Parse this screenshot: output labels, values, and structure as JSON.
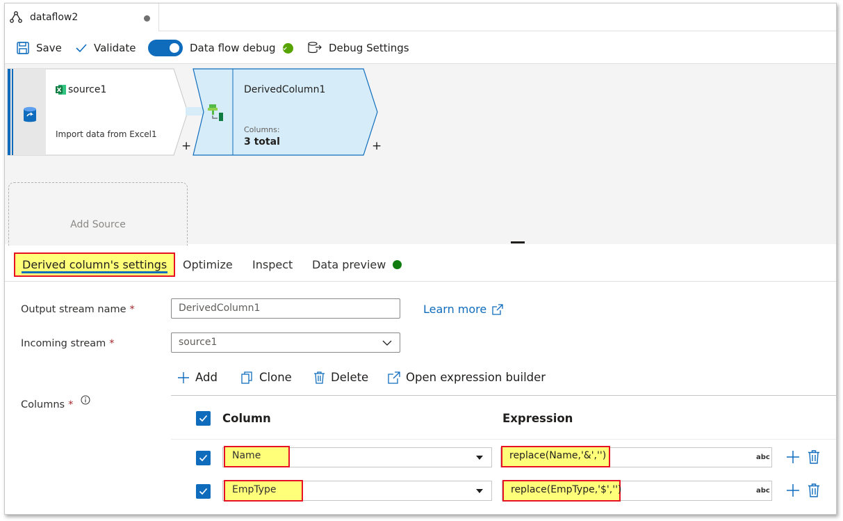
{
  "tab": {
    "title": "dataflow2"
  },
  "toolbar": {
    "save": "Save",
    "validate": "Validate",
    "debug": "Data flow debug",
    "debug_settings": "Debug Settings"
  },
  "canvas": {
    "source": {
      "title": "source1",
      "desc": "Import data from Excel1"
    },
    "derived": {
      "title": "DerivedColumn1",
      "label": "Columns:",
      "value": "3 total"
    },
    "add_source": "Add Source"
  },
  "props": {
    "tabs": [
      "Derived column's settings",
      "Optimize",
      "Inspect",
      "Data preview"
    ],
    "output_label": "Output stream name",
    "output_value": "DerivedColumn1",
    "learn_more": "Learn more",
    "incoming_label": "Incoming stream",
    "incoming_value": "source1",
    "columns_label": "Columns",
    "required_mark": "*",
    "commands": {
      "add": "Add",
      "clone": "Clone",
      "delete": "Delete",
      "open_builder": "Open expression builder"
    },
    "headers": {
      "column": "Column",
      "expression": "Expression"
    },
    "rows": [
      {
        "column": "Name",
        "expression": "replace(Name,'&','')",
        "type": "abc"
      },
      {
        "column": "EmpType",
        "expression": "replace(EmpType,'$','')",
        "type": "abc"
      }
    ]
  },
  "colors": {
    "accent": "#0f6cbd",
    "success": "#57a300",
    "highlight": "#ffff7a",
    "highlight_border": "#e81123"
  }
}
